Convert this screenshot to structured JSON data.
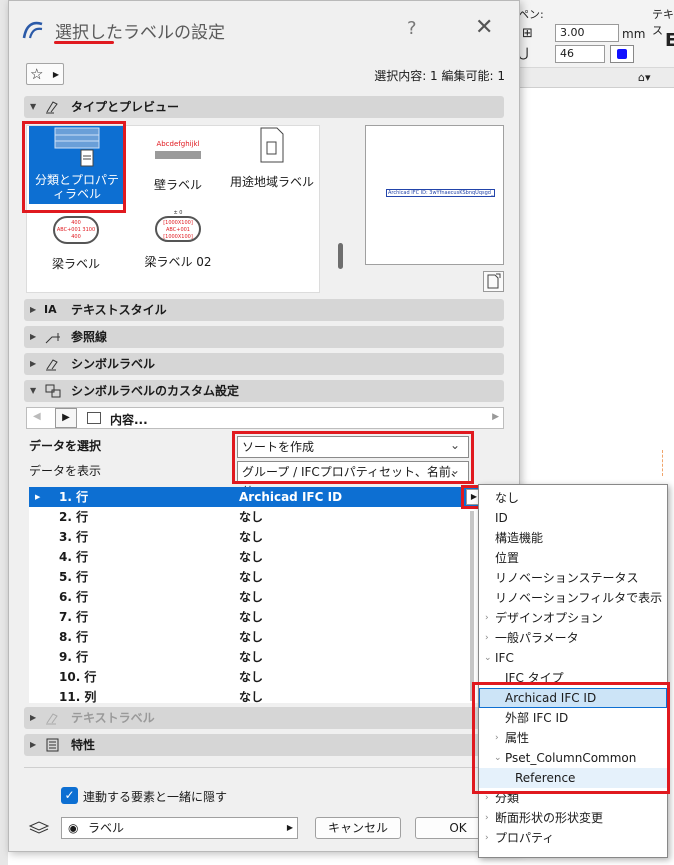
{
  "background": {
    "label_pen": "ペン:",
    "label_text": "テキス",
    "font_size_value": "3.00",
    "unit": "mm",
    "pen_value": "46",
    "truncated_e": "E"
  },
  "dialog": {
    "title": "選択したラベルの設定",
    "help": "?",
    "close": "✕",
    "selection_info": "選択内容: 1 編集可能: 1"
  },
  "sections": {
    "type_preview": "タイプとプレビュー",
    "text_style": "テキストスタイル",
    "leader": "参照線",
    "symbol_label": "シンボルラベル",
    "symbol_custom": "シンボルラベルのカスタム設定",
    "text_label": "テキストラベル",
    "properties": "特性"
  },
  "types": [
    {
      "label": "分類とプロパティラベル",
      "selected": true
    },
    {
      "label": "壁ラベル",
      "thumb_text": "Abcdefghijkl"
    },
    {
      "label": "用途地域ラベル"
    },
    {
      "label": "梁ラベル",
      "thumb_lines": [
        "400",
        "ABC+001 3100",
        "400"
      ]
    },
    {
      "label": "梁ラベル 02",
      "thumb_lines": [
        "± 0",
        "[1000X100]",
        "ABC+001",
        "[1000X100]"
      ]
    }
  ],
  "preview": {
    "text": "Archicad IFC ID: 3wYfnaecusKSbnqUqsgd_"
  },
  "content_nav": {
    "label": "内容..."
  },
  "fields": {
    "select_data_label": "データを選択",
    "select_data_value": "ソートを作成",
    "display_data_label": "データを表示",
    "display_data_value": "グループ / IFCプロパティセット、名前、値"
  },
  "rows": [
    {
      "name": "1. 行",
      "value": "Archicad IFC ID"
    },
    {
      "name": "2. 行",
      "value": "なし"
    },
    {
      "name": "3. 行",
      "value": "なし"
    },
    {
      "name": "4. 行",
      "value": "なし"
    },
    {
      "name": "5. 行",
      "value": "なし"
    },
    {
      "name": "6. 行",
      "value": "なし"
    },
    {
      "name": "7. 行",
      "value": "なし"
    },
    {
      "name": "8. 行",
      "value": "なし"
    },
    {
      "name": "9. 行",
      "value": "なし"
    },
    {
      "name": "10. 行",
      "value": "なし"
    },
    {
      "name": "11. 列",
      "value": "なし"
    }
  ],
  "footer": {
    "hide_with_element": "連動する要素と一緒に隠す",
    "layer": "ラベル",
    "cancel": "キャンセル",
    "ok": "OK"
  },
  "menu": [
    {
      "label": "なし"
    },
    {
      "label": "ID"
    },
    {
      "label": "構造機能"
    },
    {
      "label": "位置"
    },
    {
      "label": "リノベーションステータス"
    },
    {
      "label": "リノベーションフィルタで表示"
    },
    {
      "label": "デザインオプション",
      "submenu": "›"
    },
    {
      "label": "一般パラメータ",
      "submenu": "›"
    },
    {
      "label": "IFC",
      "submenu": "⌄"
    },
    {
      "label": "IFC タイプ"
    },
    {
      "label": "Archicad IFC ID",
      "highlighted": true
    },
    {
      "label": "外部 IFC ID"
    },
    {
      "label": "属性",
      "submenu": "›"
    },
    {
      "label": "Pset_ColumnCommon",
      "submenu": "⌄"
    },
    {
      "label": "Reference"
    },
    {
      "label": "分類",
      "submenu": "›"
    },
    {
      "label": "断面形状の形状変更",
      "submenu": "›"
    },
    {
      "label": "プロパティ",
      "submenu": "›"
    }
  ],
  "colors": {
    "selection_blue": "#0d6fd2",
    "annotation_red": "#e0191f",
    "menu_highlight": "#cce4f7"
  }
}
